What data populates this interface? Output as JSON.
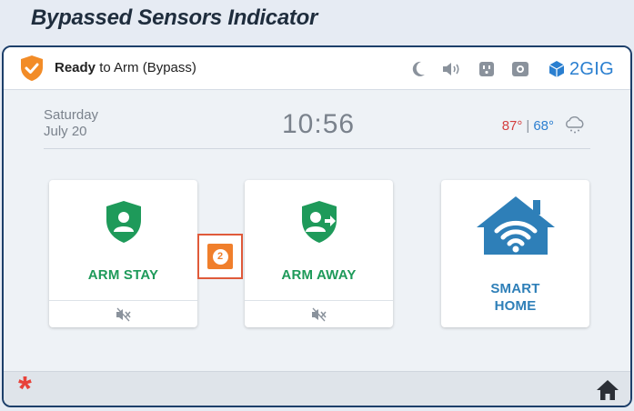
{
  "caption": "Bypassed Sensors Indicator",
  "topbar": {
    "status_bold": "Ready",
    "status_rest": " to Arm (Bypass)",
    "status_icon": "shield-check-icon",
    "icons": [
      "moon-icon",
      "speaker-icon",
      "outlet-icon",
      "camera-icon"
    ],
    "brand": "2GIG"
  },
  "info": {
    "day": "Saturday",
    "date": "July 20",
    "time": "10:56",
    "temp_high": "87°",
    "temp_sep": "|",
    "temp_low": "68°",
    "weather_icon": "rain-cloud-icon"
  },
  "tiles": {
    "arm_stay": "ARM STAY",
    "arm_away": "ARM AWAY",
    "smart_home_line1": "SMART",
    "smart_home_line2": "HOME"
  },
  "bypass_count": "2",
  "bottom": {
    "emergency_icon": "asterisk-icon",
    "home_icon": "home-icon"
  },
  "colors": {
    "accent_green": "#1e9a5a",
    "accent_blue": "#2e7fb8",
    "bypass_orange": "#f07f2c",
    "frame": "#1d3f6a"
  }
}
